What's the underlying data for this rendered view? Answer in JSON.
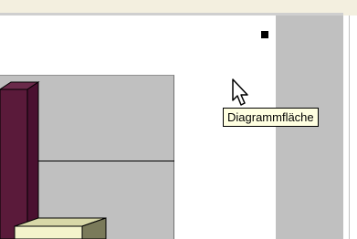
{
  "tooltip": {
    "text": "Diagrammfläche"
  },
  "chart_data": {
    "type": "bar",
    "bar_colors": [
      "#5a1a3a",
      "#f4f4cc"
    ]
  },
  "colors": {
    "plot_area": "#c0c0c0",
    "chart_area": "#ffffff",
    "tooltip_bg": "#ffffe1",
    "right_pane": "#c0c0c0"
  },
  "icons": {
    "selection_handle": "selection-handle-icon",
    "cursor": "mouse-pointer-icon"
  }
}
